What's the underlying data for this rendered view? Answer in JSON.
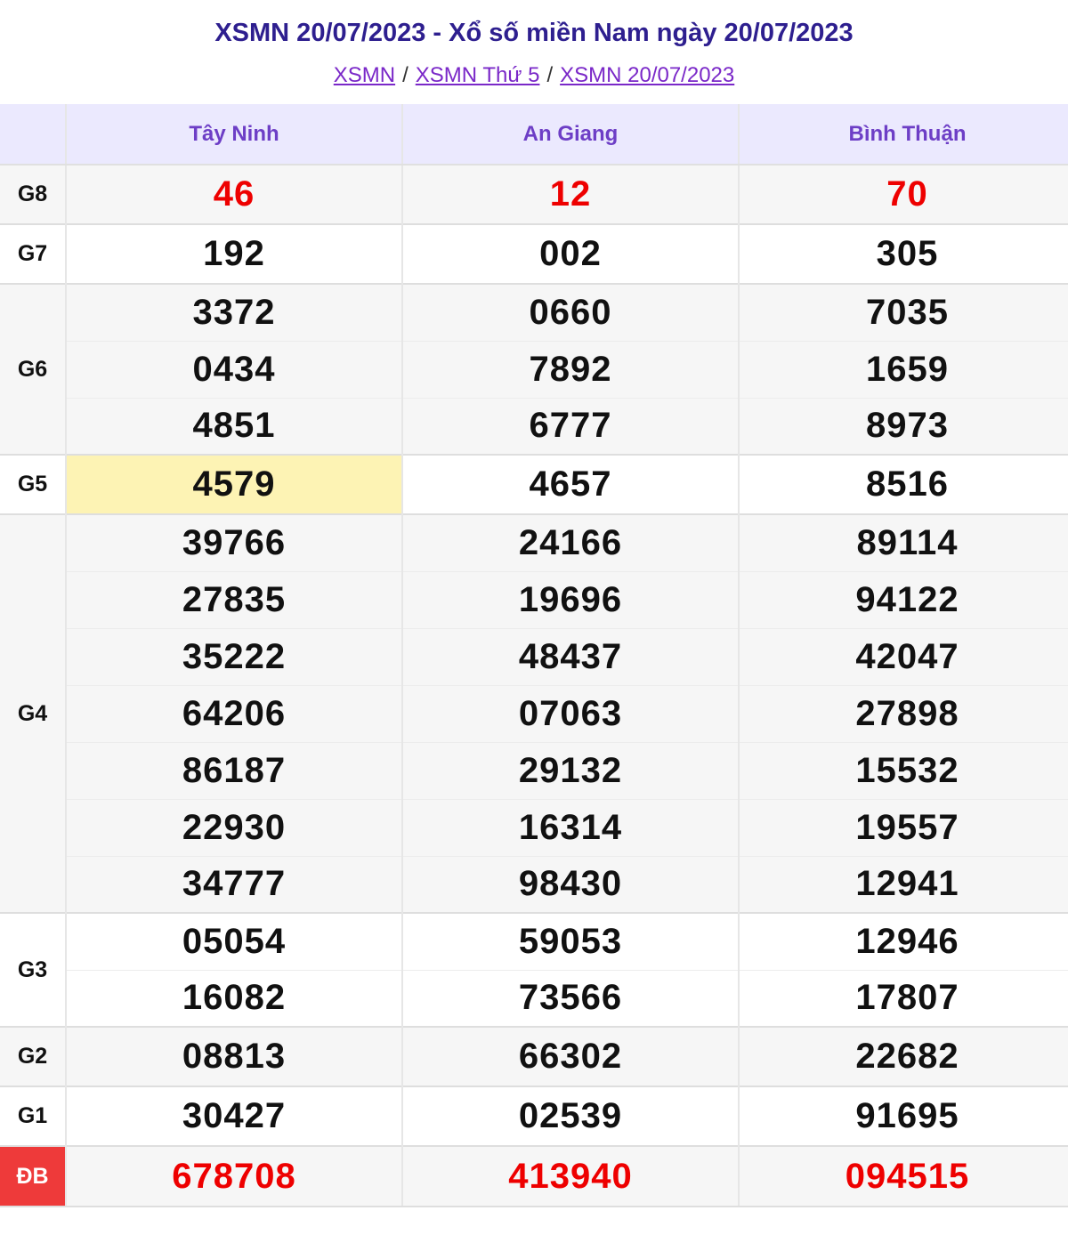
{
  "title": "XSMN 20/07/2023 - Xổ số miền Nam ngày 20/07/2023",
  "breadcrumb": [
    "XSMN",
    "XSMN Thứ 5",
    "XSMN 20/07/2023"
  ],
  "provinces": [
    "Tây Ninh",
    "An Giang",
    "Bình Thuận"
  ],
  "prizes": {
    "g8": {
      "label": "G8",
      "values": [
        "46",
        "12",
        "70"
      ]
    },
    "g7": {
      "label": "G7",
      "values": [
        "192",
        "002",
        "305"
      ]
    },
    "g6": {
      "label": "G6",
      "rows": [
        [
          "3372",
          "0660",
          "7035"
        ],
        [
          "0434",
          "7892",
          "1659"
        ],
        [
          "4851",
          "6777",
          "8973"
        ]
      ]
    },
    "g5": {
      "label": "G5",
      "values": [
        "4579",
        "4657",
        "8516"
      ]
    },
    "g4": {
      "label": "G4",
      "rows": [
        [
          "39766",
          "24166",
          "89114"
        ],
        [
          "27835",
          "19696",
          "94122"
        ],
        [
          "35222",
          "48437",
          "42047"
        ],
        [
          "64206",
          "07063",
          "27898"
        ],
        [
          "86187",
          "29132",
          "15532"
        ],
        [
          "22930",
          "16314",
          "19557"
        ],
        [
          "34777",
          "98430",
          "12941"
        ]
      ]
    },
    "g3": {
      "label": "G3",
      "rows": [
        [
          "05054",
          "59053",
          "12946"
        ],
        [
          "16082",
          "73566",
          "17807"
        ]
      ]
    },
    "g2": {
      "label": "G2",
      "values": [
        "08813",
        "66302",
        "22682"
      ]
    },
    "g1": {
      "label": "G1",
      "values": [
        "30427",
        "02539",
        "91695"
      ]
    },
    "db": {
      "label": "ĐB",
      "values": [
        "678708",
        "413940",
        "094515"
      ]
    }
  },
  "colors": {
    "title": "#2e1f8f",
    "link": "#7a28c8",
    "header_bg": "#ebe9fe",
    "header_text": "#6d3ec6",
    "red_number": "#ee0000",
    "special_badge": "#ee3a3a",
    "highlight": "#fdf3b4"
  }
}
